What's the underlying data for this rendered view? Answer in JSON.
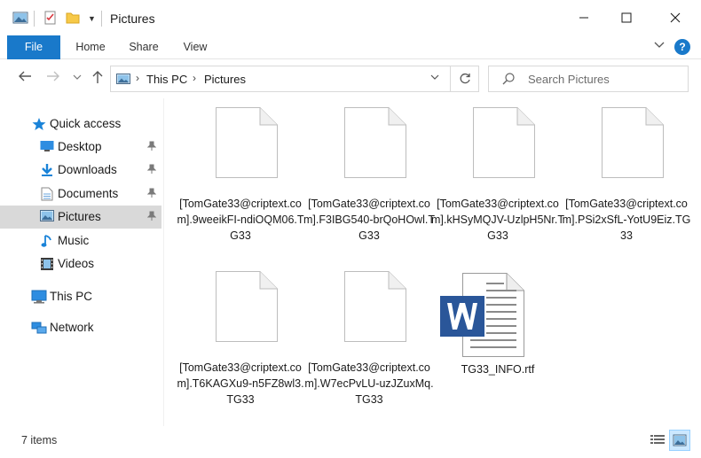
{
  "window": {
    "title": "Pictures"
  },
  "ribbon": {
    "tabs": [
      "File",
      "Home",
      "Share",
      "View"
    ]
  },
  "address": {
    "segments": [
      "This PC",
      "Pictures"
    ]
  },
  "search": {
    "placeholder": "Search Pictures"
  },
  "sidebar": {
    "quick_access": "Quick access",
    "items": [
      {
        "label": "Desktop",
        "icon": "desktop-icon",
        "pinned": true
      },
      {
        "label": "Downloads",
        "icon": "downloads-icon",
        "pinned": true
      },
      {
        "label": "Documents",
        "icon": "documents-icon",
        "pinned": true
      },
      {
        "label": "Pictures",
        "icon": "pictures-icon",
        "pinned": true,
        "selected": true
      },
      {
        "label": "Music",
        "icon": "music-icon",
        "pinned": false
      },
      {
        "label": "Videos",
        "icon": "videos-icon",
        "pinned": false
      }
    ],
    "this_pc": "This PC",
    "network": "Network"
  },
  "files": [
    {
      "name": "[TomGate33@criptext.com].9weeikFI-ndiOQM06.TG33",
      "type": "blank"
    },
    {
      "name": "[TomGate33@criptext.com].F3IBG540-brQoHOwl.TG33",
      "type": "blank"
    },
    {
      "name": "[TomGate33@criptext.com].kHSyMQJV-UzlpH5Nr.TG33",
      "type": "blank"
    },
    {
      "name": "[TomGate33@criptext.com].PSi2xSfL-YotU9Eiz.TG33",
      "type": "blank"
    },
    {
      "name": "[TomGate33@criptext.com].T6KAGXu9-n5FZ8wl3.TG33",
      "type": "blank"
    },
    {
      "name": "[TomGate33@criptext.com].W7ecPvLU-uzJZuxMq.TG33",
      "type": "blank"
    },
    {
      "name": "TG33_INFO.rtf",
      "type": "word"
    }
  ],
  "status": {
    "count": "7 items"
  },
  "colors": {
    "accent": "#1979ca",
    "selected": "#d9d9d9"
  }
}
